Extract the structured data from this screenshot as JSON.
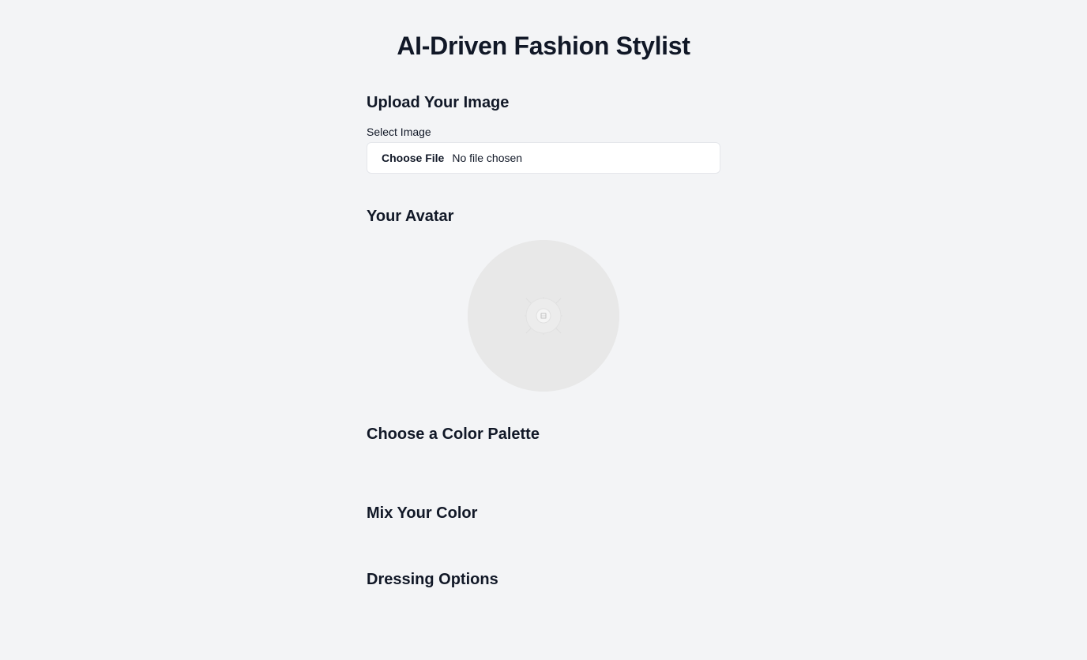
{
  "page": {
    "title": "AI-Driven Fashion Stylist"
  },
  "upload": {
    "heading": "Upload Your Image",
    "field_label": "Select Image",
    "button_label": "Choose File",
    "status_text": "No file chosen"
  },
  "avatar": {
    "heading": "Your Avatar",
    "placeholder_icon": "broken-image-icon"
  },
  "palette": {
    "heading": "Choose a Color Palette"
  },
  "mixer": {
    "heading": "Mix Your Color"
  },
  "dressing": {
    "heading": "Dressing Options"
  },
  "colors": {
    "background": "#f3f4f6",
    "text": "#111827",
    "input_border": "#e5e7eb",
    "avatar_bg": "#e8e8e8"
  }
}
